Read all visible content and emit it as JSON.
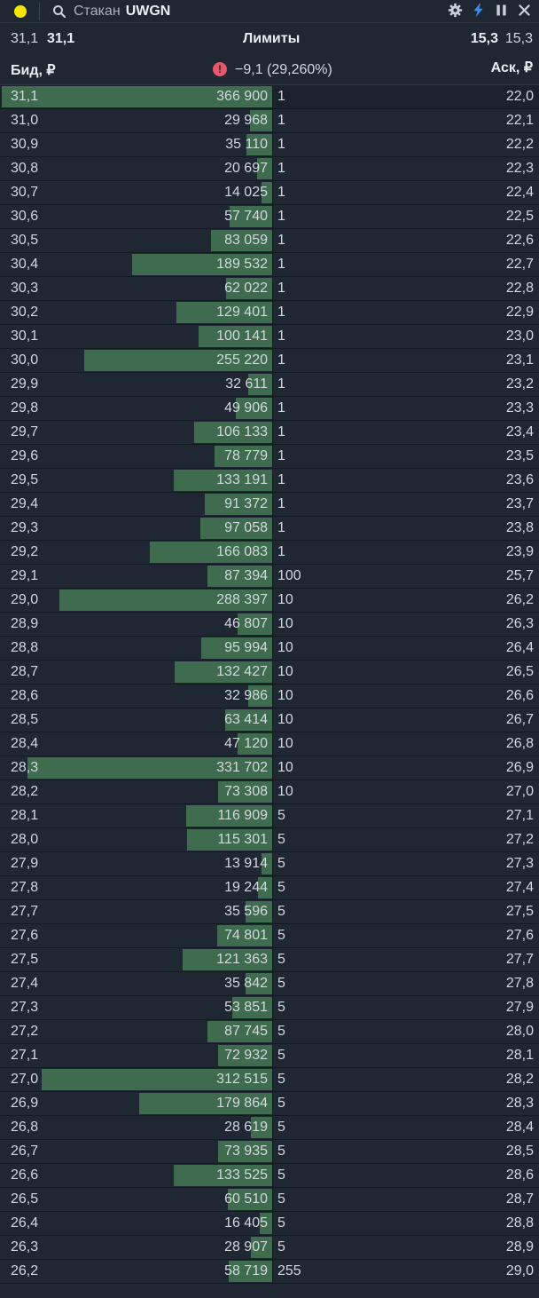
{
  "header": {
    "title_label": "Стакан",
    "ticker": "UWGN",
    "icons": [
      "settings-icon",
      "lightning-icon",
      "pause-icon",
      "close-icon"
    ]
  },
  "limits": {
    "left_1": "31,1",
    "left_2": "31,1",
    "label": "Лимиты",
    "right_1": "15,3",
    "right_2": "15,3"
  },
  "columns": {
    "bid": "Бид, ₽",
    "change": "−9,1 (29,260%)",
    "ask": "Аск, ₽"
  },
  "colors": {
    "accent_dot": "#f5e500",
    "bar": "#3f6b4e",
    "warn": "#e8576a"
  },
  "max_volume": 366900,
  "rows": [
    {
      "bid": "31,1",
      "volume": "366 900",
      "v": 366900,
      "count": "1",
      "ask": "22,0"
    },
    {
      "bid": "31,0",
      "volume": "29 968",
      "v": 29968,
      "count": "1",
      "ask": "22,1"
    },
    {
      "bid": "30,9",
      "volume": "35 110",
      "v": 35110,
      "count": "1",
      "ask": "22,2"
    },
    {
      "bid": "30,8",
      "volume": "20 697",
      "v": 20697,
      "count": "1",
      "ask": "22,3"
    },
    {
      "bid": "30,7",
      "volume": "14 025",
      "v": 14025,
      "count": "1",
      "ask": "22,4"
    },
    {
      "bid": "30,6",
      "volume": "57 740",
      "v": 57740,
      "count": "1",
      "ask": "22,5"
    },
    {
      "bid": "30,5",
      "volume": "83 059",
      "v": 83059,
      "count": "1",
      "ask": "22,6"
    },
    {
      "bid": "30,4",
      "volume": "189 532",
      "v": 189532,
      "count": "1",
      "ask": "22,7"
    },
    {
      "bid": "30,3",
      "volume": "62 022",
      "v": 62022,
      "count": "1",
      "ask": "22,8"
    },
    {
      "bid": "30,2",
      "volume": "129 401",
      "v": 129401,
      "count": "1",
      "ask": "22,9"
    },
    {
      "bid": "30,1",
      "volume": "100 141",
      "v": 100141,
      "count": "1",
      "ask": "23,0"
    },
    {
      "bid": "30,0",
      "volume": "255 220",
      "v": 255220,
      "count": "1",
      "ask": "23,1"
    },
    {
      "bid": "29,9",
      "volume": "32 611",
      "v": 32611,
      "count": "1",
      "ask": "23,2"
    },
    {
      "bid": "29,8",
      "volume": "49 906",
      "v": 49906,
      "count": "1",
      "ask": "23,3"
    },
    {
      "bid": "29,7",
      "volume": "106 133",
      "v": 106133,
      "count": "1",
      "ask": "23,4"
    },
    {
      "bid": "29,6",
      "volume": "78 779",
      "v": 78779,
      "count": "1",
      "ask": "23,5"
    },
    {
      "bid": "29,5",
      "volume": "133 191",
      "v": 133191,
      "count": "1",
      "ask": "23,6"
    },
    {
      "bid": "29,4",
      "volume": "91 372",
      "v": 91372,
      "count": "1",
      "ask": "23,7"
    },
    {
      "bid": "29,3",
      "volume": "97 058",
      "v": 97058,
      "count": "1",
      "ask": "23,8"
    },
    {
      "bid": "29,2",
      "volume": "166 083",
      "v": 166083,
      "count": "1",
      "ask": "23,9"
    },
    {
      "bid": "29,1",
      "volume": "87 394",
      "v": 87394,
      "count": "100",
      "ask": "25,7"
    },
    {
      "bid": "29,0",
      "volume": "288 397",
      "v": 288397,
      "count": "10",
      "ask": "26,2"
    },
    {
      "bid": "28,9",
      "volume": "46 807",
      "v": 46807,
      "count": "10",
      "ask": "26,3"
    },
    {
      "bid": "28,8",
      "volume": "95 994",
      "v": 95994,
      "count": "10",
      "ask": "26,4"
    },
    {
      "bid": "28,7",
      "volume": "132 427",
      "v": 132427,
      "count": "10",
      "ask": "26,5"
    },
    {
      "bid": "28,6",
      "volume": "32 986",
      "v": 32986,
      "count": "10",
      "ask": "26,6"
    },
    {
      "bid": "28,5",
      "volume": "63 414",
      "v": 63414,
      "count": "10",
      "ask": "26,7"
    },
    {
      "bid": "28,4",
      "volume": "47 120",
      "v": 47120,
      "count": "10",
      "ask": "26,8"
    },
    {
      "bid": "28,3",
      "volume": "331 702",
      "v": 331702,
      "count": "10",
      "ask": "26,9"
    },
    {
      "bid": "28,2",
      "volume": "73 308",
      "v": 73308,
      "count": "10",
      "ask": "27,0"
    },
    {
      "bid": "28,1",
      "volume": "116 909",
      "v": 116909,
      "count": "5",
      "ask": "27,1"
    },
    {
      "bid": "28,0",
      "volume": "115 301",
      "v": 115301,
      "count": "5",
      "ask": "27,2"
    },
    {
      "bid": "27,9",
      "volume": "13 914",
      "v": 13914,
      "count": "5",
      "ask": "27,3"
    },
    {
      "bid": "27,8",
      "volume": "19 244",
      "v": 19244,
      "count": "5",
      "ask": "27,4"
    },
    {
      "bid": "27,7",
      "volume": "35 596",
      "v": 35596,
      "count": "5",
      "ask": "27,5"
    },
    {
      "bid": "27,6",
      "volume": "74 801",
      "v": 74801,
      "count": "5",
      "ask": "27,6"
    },
    {
      "bid": "27,5",
      "volume": "121 363",
      "v": 121363,
      "count": "5",
      "ask": "27,7"
    },
    {
      "bid": "27,4",
      "volume": "35 842",
      "v": 35842,
      "count": "5",
      "ask": "27,8"
    },
    {
      "bid": "27,3",
      "volume": "53 851",
      "v": 53851,
      "count": "5",
      "ask": "27,9"
    },
    {
      "bid": "27,2",
      "volume": "87 745",
      "v": 87745,
      "count": "5",
      "ask": "28,0"
    },
    {
      "bid": "27,1",
      "volume": "72 932",
      "v": 72932,
      "count": "5",
      "ask": "28,1"
    },
    {
      "bid": "27,0",
      "volume": "312 515",
      "v": 312515,
      "count": "5",
      "ask": "28,2"
    },
    {
      "bid": "26,9",
      "volume": "179 864",
      "v": 179864,
      "count": "5",
      "ask": "28,3"
    },
    {
      "bid": "26,8",
      "volume": "28 619",
      "v": 28619,
      "count": "5",
      "ask": "28,4"
    },
    {
      "bid": "26,7",
      "volume": "73 935",
      "v": 73935,
      "count": "5",
      "ask": "28,5"
    },
    {
      "bid": "26,6",
      "volume": "133 525",
      "v": 133525,
      "count": "5",
      "ask": "28,6"
    },
    {
      "bid": "26,5",
      "volume": "60 510",
      "v": 60510,
      "count": "5",
      "ask": "28,7"
    },
    {
      "bid": "26,4",
      "volume": "16 405",
      "v": 16405,
      "count": "5",
      "ask": "28,8"
    },
    {
      "bid": "26,3",
      "volume": "28 907",
      "v": 28907,
      "count": "5",
      "ask": "28,9"
    },
    {
      "bid": "26,2",
      "volume": "58 719",
      "v": 58719,
      "count": "255",
      "ask": "29,0"
    }
  ]
}
